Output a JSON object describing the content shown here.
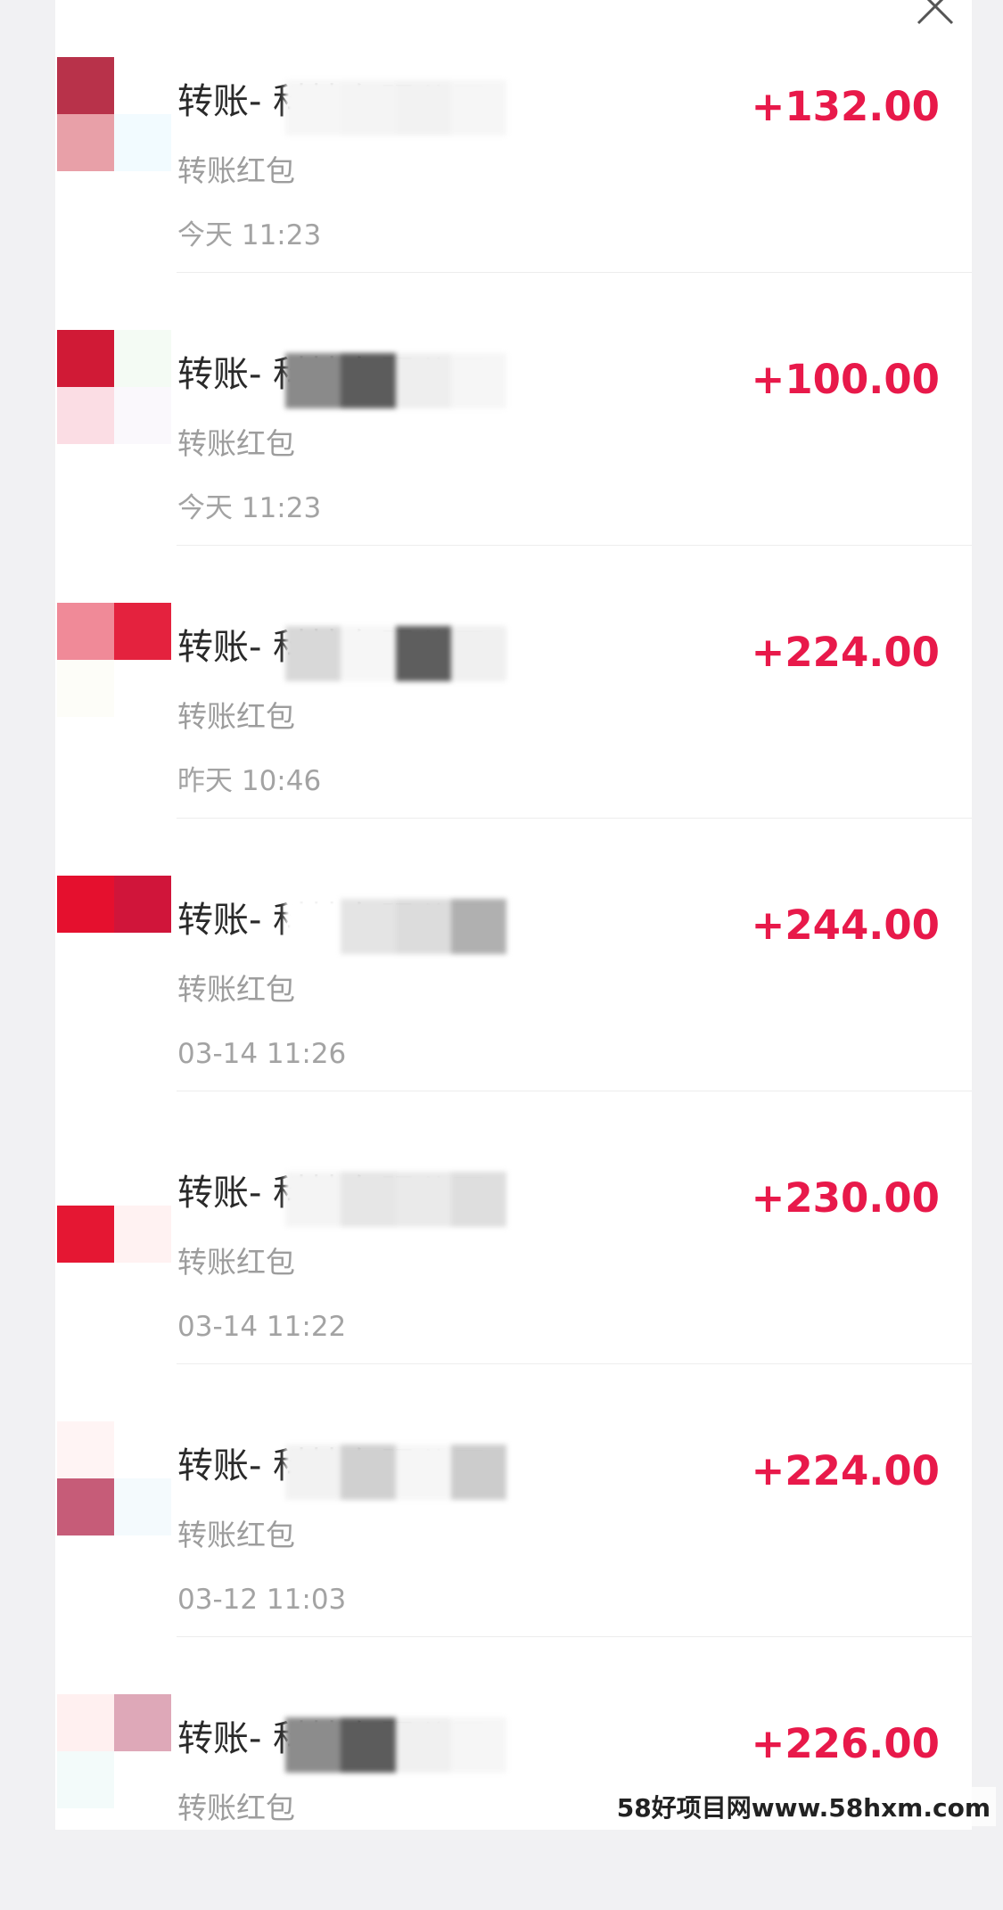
{
  "header": {
    "close_icon": "close-icon"
  },
  "colors": {
    "amount": "#e8194a",
    "title": "#2a2a2a",
    "secondary": "#9d9d9d"
  },
  "transactions": [
    {
      "title": "转账-                  科技有限公司",
      "subtitle": "转账红包",
      "time": "今天 11:23",
      "amount": "+132.00",
      "avatar_colors": [
        "#b8324a",
        "#ffffff",
        "#e8a0a8",
        "#f2fbff"
      ]
    },
    {
      "title": "转账-                  科技有限公司",
      "subtitle": "转账红包",
      "time": "今天 11:23",
      "amount": "+100.00",
      "avatar_colors": [
        "#d01a36",
        "#f4fbf4",
        "#fbdde4",
        "#faf8fc"
      ]
    },
    {
      "title": "转账-                  科技有限公司",
      "subtitle": "转账红包",
      "time": "昨天 10:46",
      "amount": "+224.00",
      "avatar_colors": [
        "#f08a98",
        "#e4223e",
        "#fdfdf8",
        "#ffffff"
      ]
    },
    {
      "title": "转账-                  科技有限公司",
      "subtitle": "转账红包",
      "time": "03-14 11:26",
      "amount": "+244.00",
      "avatar_colors": [
        "#e5102e",
        "#d0153a",
        "#ffffff",
        "#ffffff"
      ]
    },
    {
      "title": "转账-                  科技有限公司",
      "subtitle": "转账红包",
      "time": "03-14 11:22",
      "amount": "+230.00",
      "avatar_colors": [
        "#ffffff",
        "#ffffff",
        "#e51733",
        "#fff2f2"
      ]
    },
    {
      "title": "转账-                  科技有限公司",
      "subtitle": "转账红包",
      "time": "03-12 11:03",
      "amount": "+224.00",
      "avatar_colors": [
        "#fff4f4",
        "#ffffff",
        "#c65c78",
        "#f4fafd"
      ]
    },
    {
      "title": "转账-                  科技有限公司",
      "subtitle": "转账红包",
      "time": "",
      "amount": "+226.00",
      "avatar_colors": [
        "#fff0f0",
        "#dea8b8",
        "#f3fbfa",
        "#ffffff"
      ]
    }
  ],
  "watermark": {
    "text": "58好项目网www.58hxm.com"
  }
}
